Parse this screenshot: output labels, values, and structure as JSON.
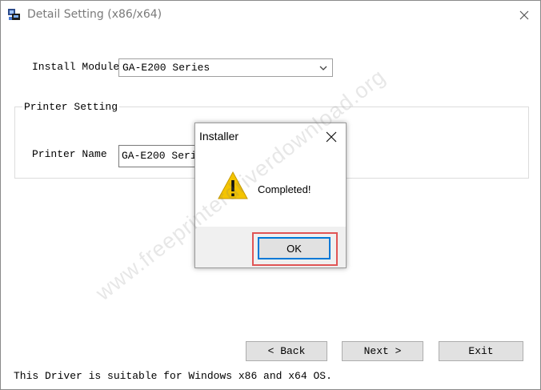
{
  "window": {
    "title": "Detail Setting (x86/x64)",
    "close_icon": "close-icon"
  },
  "install_module": {
    "label": "Install Module",
    "value": "GA-E200 Series"
  },
  "printer_setting": {
    "group_title": "Printer Setting",
    "printer_name_label": "Printer Name",
    "printer_name_value": "GA-E200 Series"
  },
  "buttons": {
    "back": "< Back",
    "next": "Next >",
    "exit": "Exit"
  },
  "footer_note": "This Driver is suitable for Windows x86 and x64 OS.",
  "dialog": {
    "title": "Installer",
    "message": "Completed!",
    "ok": "OK"
  },
  "watermark": "www.freeprinterdriverdownload.org",
  "colors": {
    "focus_blue": "#0078d7",
    "highlight_red": "#e05555",
    "warning_yellow": "#f4c400"
  }
}
